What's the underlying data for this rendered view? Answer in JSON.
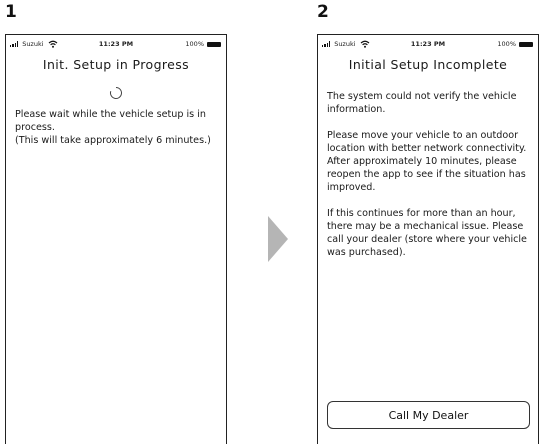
{
  "steps": [
    {
      "number": "1",
      "status_bar": {
        "carrier": "Suzuki",
        "time": "11:23 PM",
        "battery": "100%"
      },
      "title": "Init. Setup in Progress",
      "messages": [
        "Please wait while the vehicle setup is in process.",
        "(This will take approximately 6 minutes.)"
      ]
    },
    {
      "number": "2",
      "status_bar": {
        "carrier": "Suzuki",
        "time": "11:23 PM",
        "battery": "100%"
      },
      "title": "Initial Setup Incomplete",
      "messages": [
        "The system could not verify the vehicle information.",
        "Please move your vehicle to an outdoor location with better network connectivity. After approximately 10 minutes, please reopen the app to see if the situation has improved.",
        "If this continues for more than an hour, there may be a mechanical issue. Please call your dealer (store where your vehicle was purchased)."
      ],
      "button_label": "Call My Dealer"
    }
  ],
  "colors": {
    "arrow": "#b5b5b5",
    "border": "#222222"
  },
  "icons": [
    "signal-icon",
    "wifi-icon",
    "battery-icon",
    "loading-spinner-icon",
    "next-arrow-icon"
  ]
}
